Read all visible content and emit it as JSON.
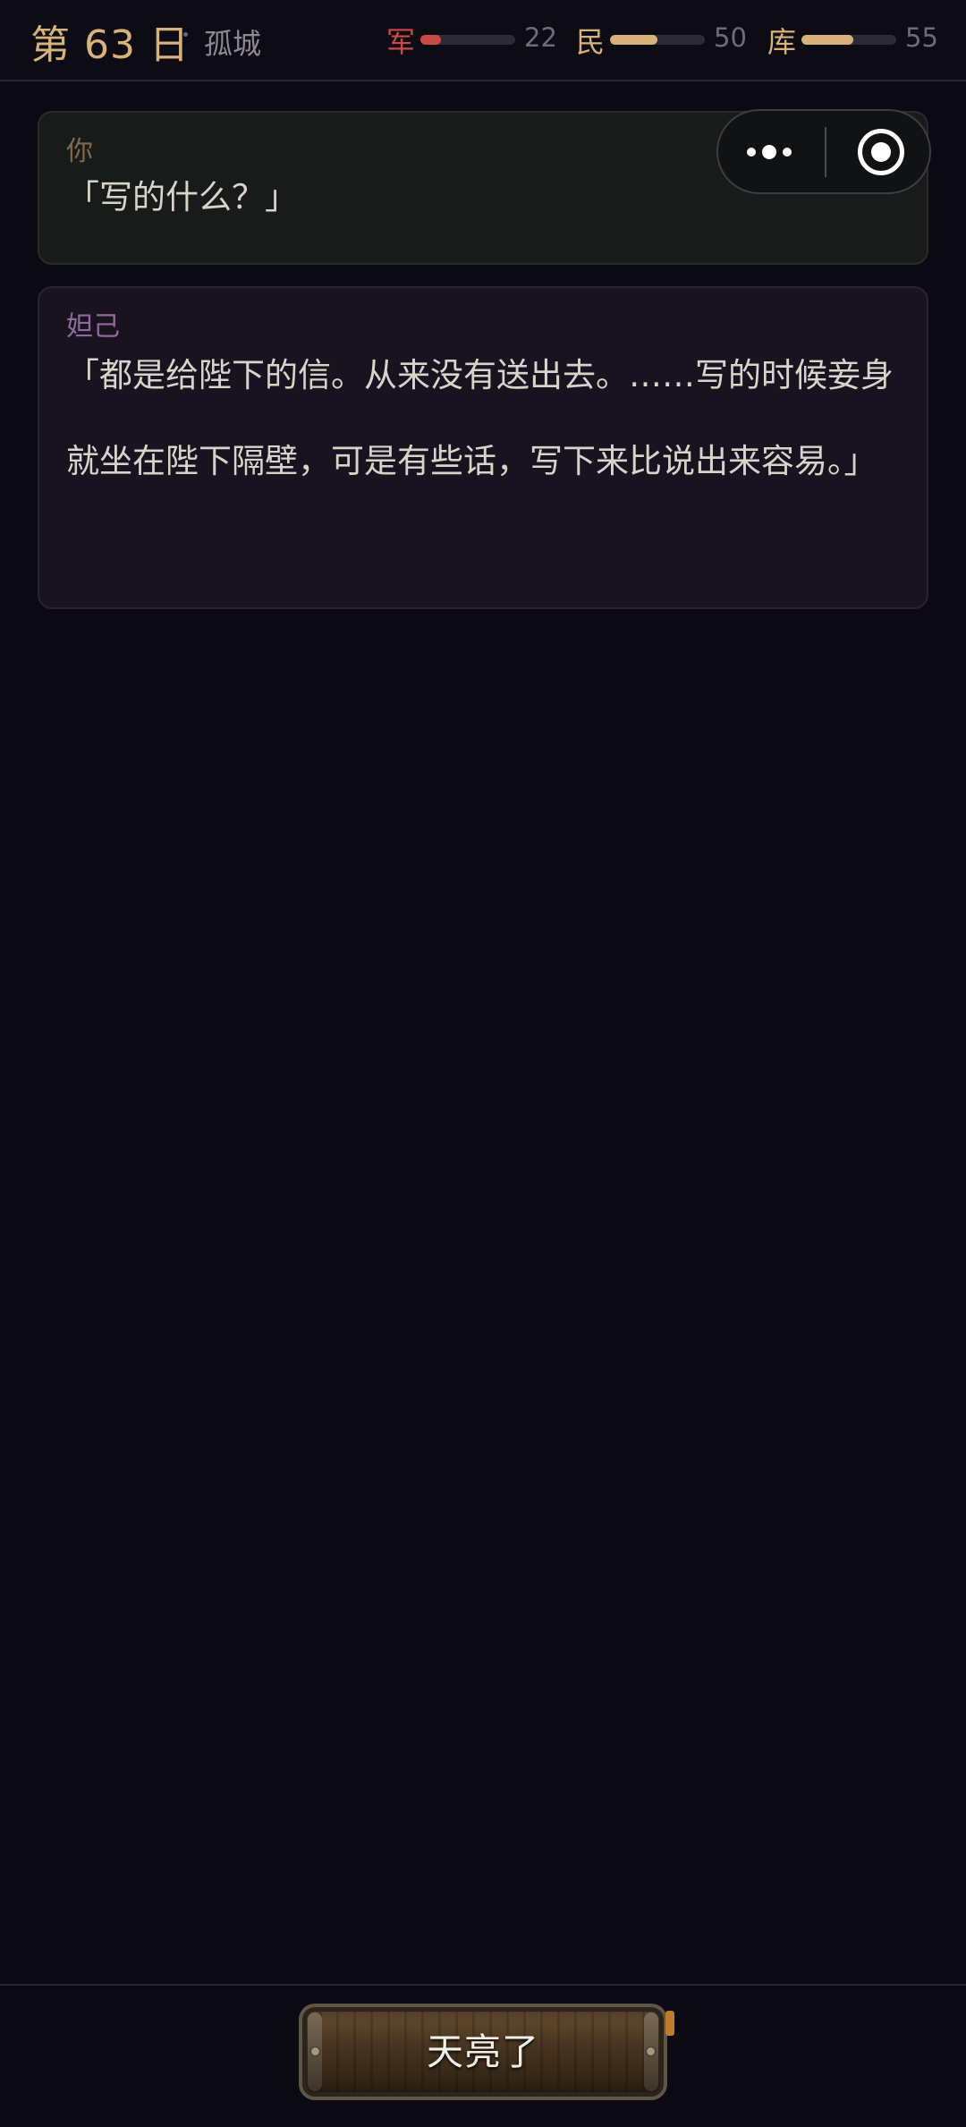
{
  "header": {
    "day_label": "第 63 日",
    "location": "孤城",
    "stats": [
      {
        "label": "军",
        "value": 22,
        "color": "#c94a44"
      },
      {
        "label": "民",
        "value": 50,
        "color": "#d7b27a"
      },
      {
        "label": "库",
        "value": 55,
        "color": "#d7b27a"
      }
    ]
  },
  "capsule": {
    "icons": [
      "more-dots-icon",
      "close-target-icon"
    ]
  },
  "dialogue": [
    {
      "speaker": "你",
      "text": "「写的什么？」"
    },
    {
      "speaker": "妲己",
      "text": "「都是给陛下的信。从来没有送出去。……写的时候妾身就坐在陛下隔壁，可是有些话，写下来比说出来容易。」"
    }
  ],
  "action": {
    "button_label": "天亮了"
  }
}
